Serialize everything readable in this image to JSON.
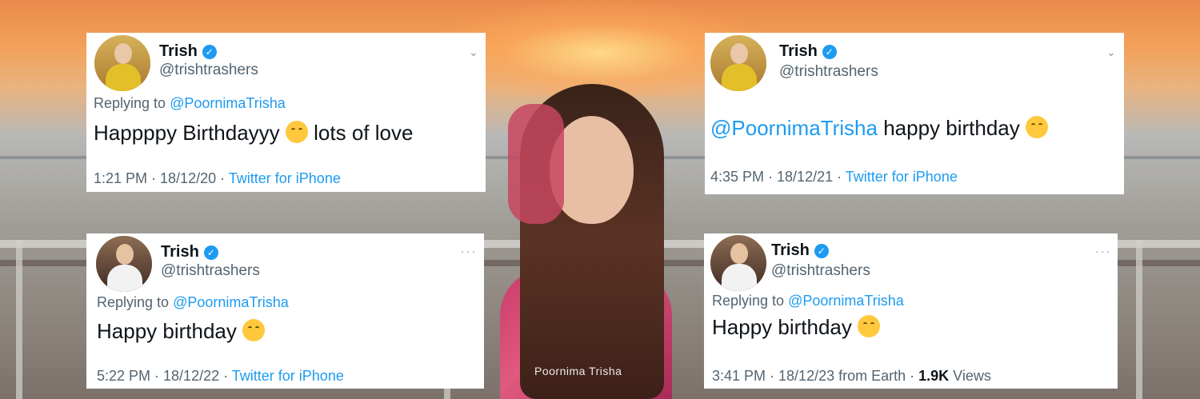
{
  "watermark": "Poornima Trisha",
  "tweets": [
    {
      "name": "Trish",
      "handle": "@trishtrashers",
      "replying_label": "Replying to",
      "replying_to": "@PoornimaTrisha",
      "text_before": "Happppy Birthdayyy",
      "text_after": "lots of love",
      "time": "1:21 PM · 18/12/20 · ",
      "source": "Twitter for iPhone",
      "menu_icon": "chevron-down-icon"
    },
    {
      "name": "Trish",
      "handle": "@trishtrashers",
      "mention": "@PoornimaTrisha",
      "text": "happy birthday",
      "time": "4:35 PM · 18/12/21 · ",
      "source": "Twitter for iPhone",
      "menu_icon": "chevron-down-icon"
    },
    {
      "name": "Trish",
      "handle": "@trishtrashers",
      "replying_label": "Replying to",
      "replying_to": "@PoornimaTrisha",
      "text": "Happy birthday",
      "time": "5:22 PM · 18/12/22 · ",
      "source": "Twitter for iPhone",
      "menu_icon": "more-icon"
    },
    {
      "name": "Trish",
      "handle": "@trishtrashers",
      "replying_label": "Replying to",
      "replying_to": "@PoornimaTrisha",
      "text": "Happy birthday",
      "time": "3:41 PM · 18/12/23 from Earth · ",
      "views_count": "1.9K",
      "views_label": "Views",
      "menu_icon": "more-icon"
    }
  ],
  "colors": {
    "link": "#1d9bf0",
    "secondary_text": "#536471",
    "verified": "#1d9bf0"
  }
}
